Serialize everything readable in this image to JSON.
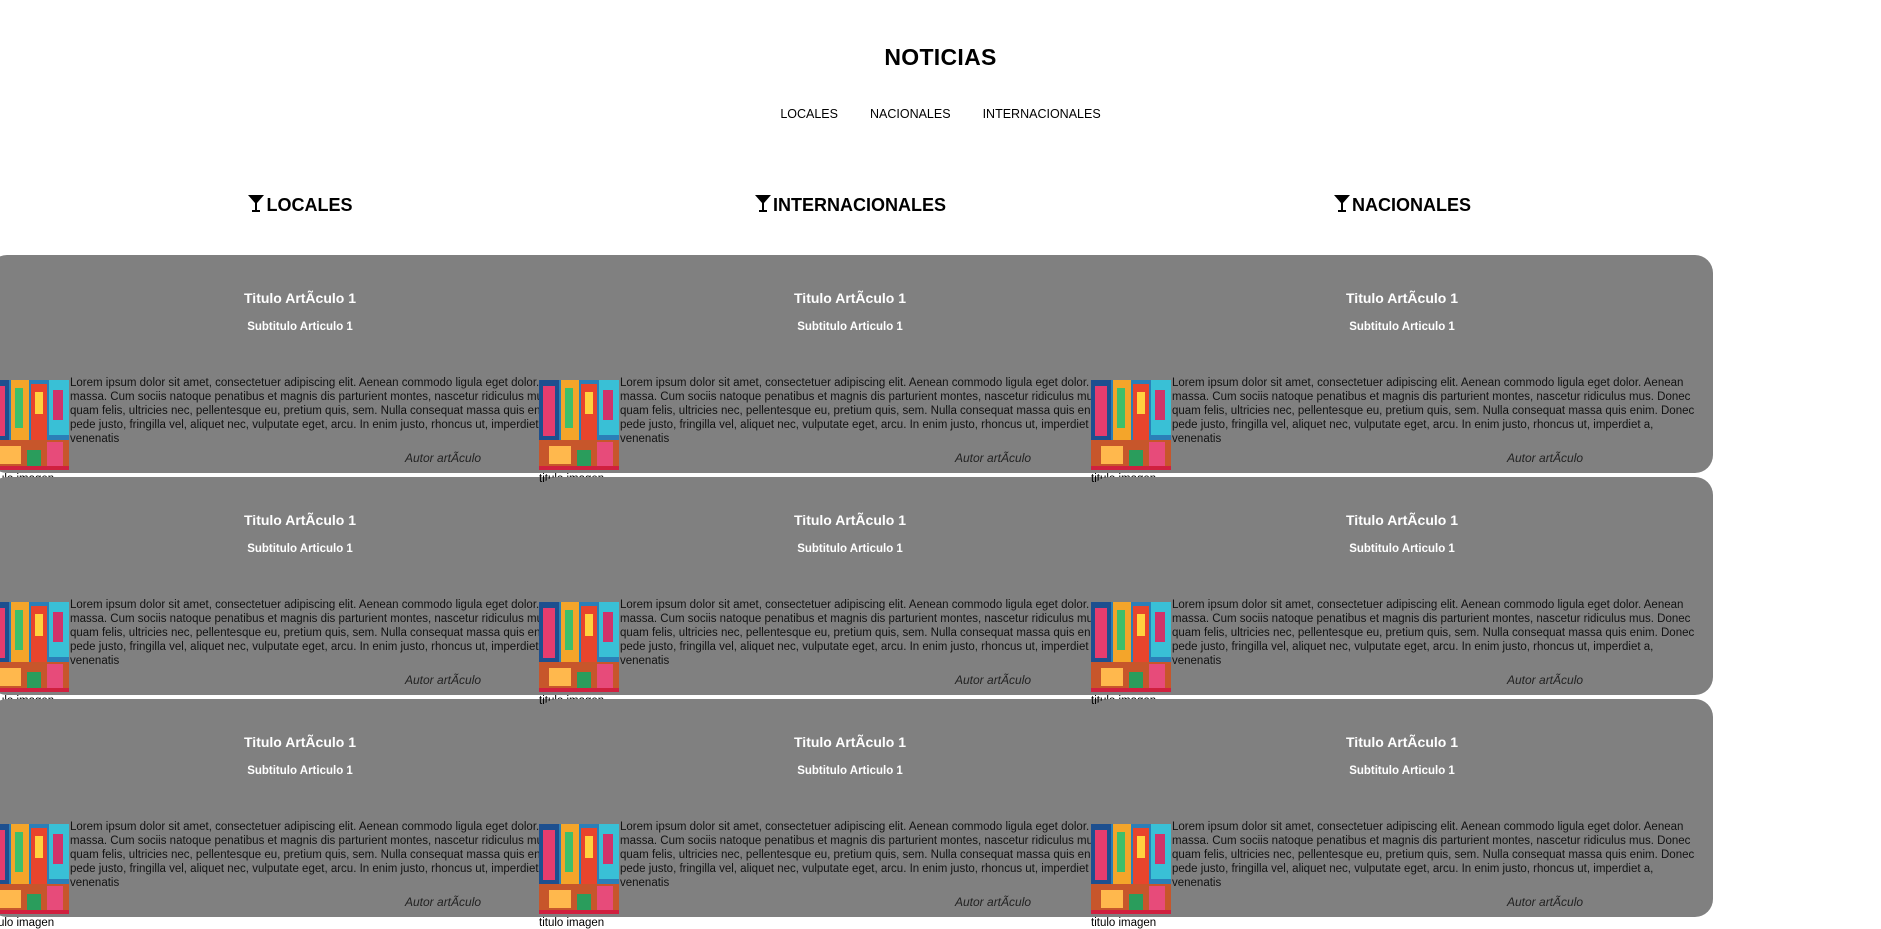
{
  "header": {
    "title": "NOTICIAS"
  },
  "nav": [
    {
      "label": "LOCALES"
    },
    {
      "label": "NACIONALES"
    },
    {
      "label": "INTERNACIONALES"
    }
  ],
  "columns": [
    {
      "heading": "LOCALES"
    },
    {
      "heading": "INTERNACIONALES"
    },
    {
      "heading": "NACIONALES"
    }
  ],
  "article": {
    "title": "Titulo ArtÃculo 1",
    "subtitle": "Subtitulo Articulo 1",
    "body": "Lorem ipsum dolor sit amet, consectetuer adipiscing elit. Aenean commodo ligula eget dolor. Aenean massa. Cum sociis natoque penatibus et magnis dis parturient montes, nascetur ridiculus mus. Donec quam felis, ultricies nec, pellentesque eu, pretium quis, sem. Nulla consequat massa quis enim. Donec pede justo, fringilla vel, aliquet nec, vulputate eget, arcu. In enim justo, rhoncus ut, imperdiet a, venenatis",
    "author": "Autor artÃculo",
    "image_caption": "titulo imagen"
  },
  "icons": {
    "column_heading_icon": "cocktail-filter-icon"
  },
  "colors": {
    "card_bg": "#808080",
    "card_text": "#ffffff",
    "page_bg": "#ffffff"
  }
}
